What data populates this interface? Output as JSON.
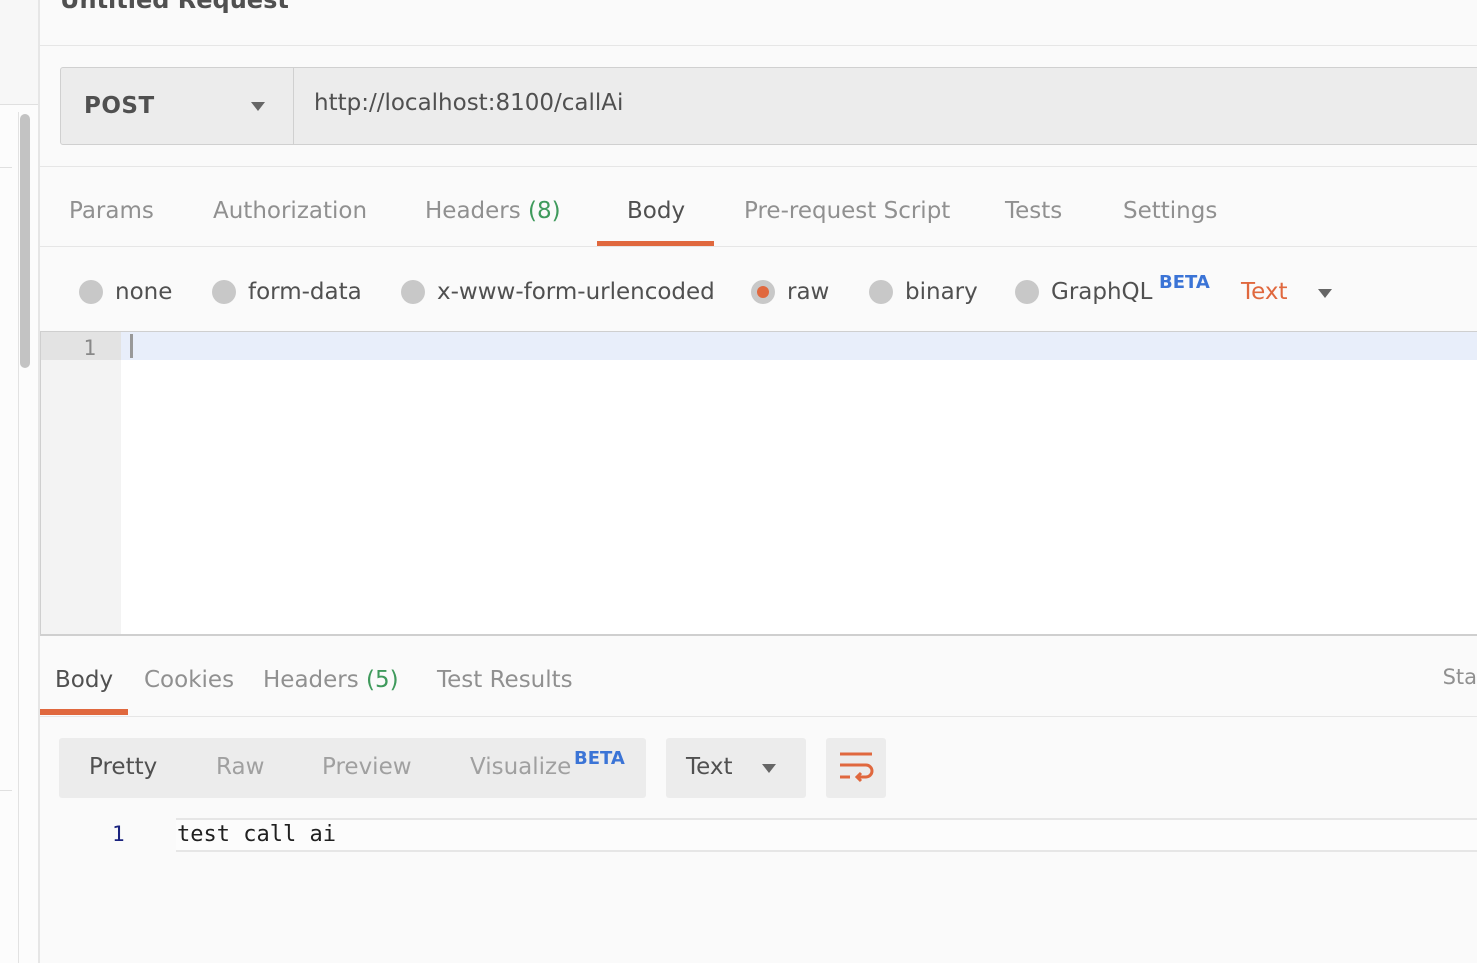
{
  "request": {
    "title": "Untitled Request",
    "method": "POST",
    "url": "http://localhost:8100/callAi"
  },
  "request_tabs": {
    "params": "Params",
    "authorization": "Authorization",
    "headers": "Headers",
    "headers_count": "(8)",
    "body": "Body",
    "prerequest": "Pre-request Script",
    "tests": "Tests",
    "settings": "Settings"
  },
  "body_types": {
    "none": "none",
    "form_data": "form-data",
    "urlencoded": "x-www-form-urlencoded",
    "raw": "raw",
    "binary": "binary",
    "graphql": "GraphQL",
    "graphql_badge": "BETA",
    "selected": "raw",
    "raw_format": "Text"
  },
  "editor": {
    "line_number": "1",
    "content": ""
  },
  "response_tabs": {
    "body": "Body",
    "cookies": "Cookies",
    "headers": "Headers",
    "headers_count": "(5)",
    "test_results": "Test Results",
    "status_partial": "Sta"
  },
  "response_view": {
    "pretty": "Pretty",
    "raw": "Raw",
    "preview": "Preview",
    "visualize": "Visualize",
    "visualize_badge": "BETA",
    "language": "Text"
  },
  "response_body": {
    "line_number": "1",
    "content": "test call ai"
  },
  "colors": {
    "accent": "#e0683e",
    "count_green": "#3f9a5c",
    "beta_blue": "#3b74d6"
  }
}
